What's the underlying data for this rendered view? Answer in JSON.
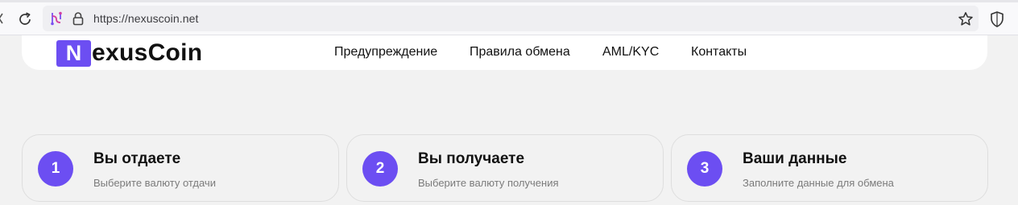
{
  "browser": {
    "url": "https://nexuscoin.net",
    "icons": {
      "reload": "reload-icon",
      "site": "site-permissions-icon",
      "lock": "lock-icon",
      "bookmark": "star-icon",
      "protection": "shield-icon"
    }
  },
  "site": {
    "logo": {
      "mark": "N",
      "text": "exusCoin"
    },
    "nav": [
      {
        "label": "Предупреждение"
      },
      {
        "label": "Правила обмена"
      },
      {
        "label": "AML/KYC"
      },
      {
        "label": "Контакты"
      }
    ],
    "steps": [
      {
        "number": "1",
        "title": "Вы отдаете",
        "subtitle": "Выберите валюту отдачи"
      },
      {
        "number": "2",
        "title": "Вы получаете",
        "subtitle": "Выберите валюту получения"
      },
      {
        "number": "3",
        "title": "Ваши данные",
        "subtitle": "Заполните данные для обмена"
      }
    ]
  },
  "colors": {
    "accent": "#6c4ef2",
    "page_background": "#f2f2f2",
    "header_background": "#ffffff",
    "muted_text": "#7b7b7b"
  }
}
